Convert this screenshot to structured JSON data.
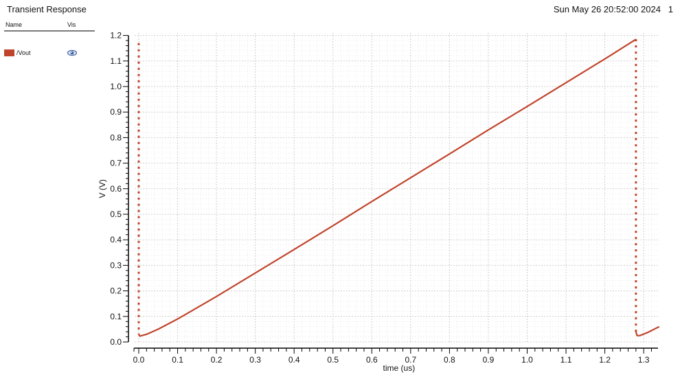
{
  "header": {
    "title": "Transient Response",
    "datestamp": "Sun May 26 20:52:00 2024   1"
  },
  "legend": {
    "col_name": "Name",
    "col_vis": "Vis",
    "items": [
      {
        "name": "/Vout",
        "color": "#c0442b",
        "visible_icon": "eye-icon"
      }
    ]
  },
  "chart_data": {
    "type": "line",
    "title": "Transient Response",
    "xlabel": "time (us)",
    "ylabel": "V (V)",
    "xlim": [
      -0.01,
      1.34
    ],
    "ylim": [
      0.0,
      1.2
    ],
    "x_ticks": [
      "0.0",
      "0.1",
      "0.2",
      "0.3",
      "0.4",
      "0.5",
      "0.6",
      "0.7",
      "0.8",
      "0.9",
      "1.0",
      "1.1",
      "1.2",
      "1.3"
    ],
    "y_ticks": [
      "0.0",
      "0.1",
      "0.2",
      "0.3",
      "0.4",
      "0.5",
      "0.6",
      "0.7",
      "0.8",
      "0.9",
      "1.0",
      "1.1",
      "1.2"
    ],
    "grid": true,
    "series": [
      {
        "name": "/Vout",
        "color": "#c0442b",
        "segments": [
          {
            "style": "dotted",
            "x": [
              0.0,
              0.0
            ],
            "y": [
              1.17,
              0.03
            ]
          },
          {
            "style": "solid",
            "x": [
              0.0,
              0.003,
              0.02,
              0.05,
              0.1,
              0.2,
              0.3,
              0.4,
              0.5,
              0.6,
              0.7,
              0.8,
              0.9,
              1.0,
              1.1,
              1.2,
              1.275,
              1.28
            ],
            "y": [
              0.03,
              0.023,
              0.03,
              0.05,
              0.09,
              0.178,
              0.27,
              0.362,
              0.455,
              0.55,
              0.643,
              0.736,
              0.83,
              0.922,
              1.015,
              1.108,
              1.18,
              1.185
            ]
          },
          {
            "style": "dotted",
            "x": [
              1.28,
              1.28
            ],
            "y": [
              1.185,
              0.04
            ]
          },
          {
            "style": "solid",
            "x": [
              1.28,
              1.283,
              1.29,
              1.31,
              1.34
            ],
            "y": [
              0.04,
              0.025,
              0.025,
              0.037,
              0.06
            ]
          }
        ]
      }
    ]
  }
}
